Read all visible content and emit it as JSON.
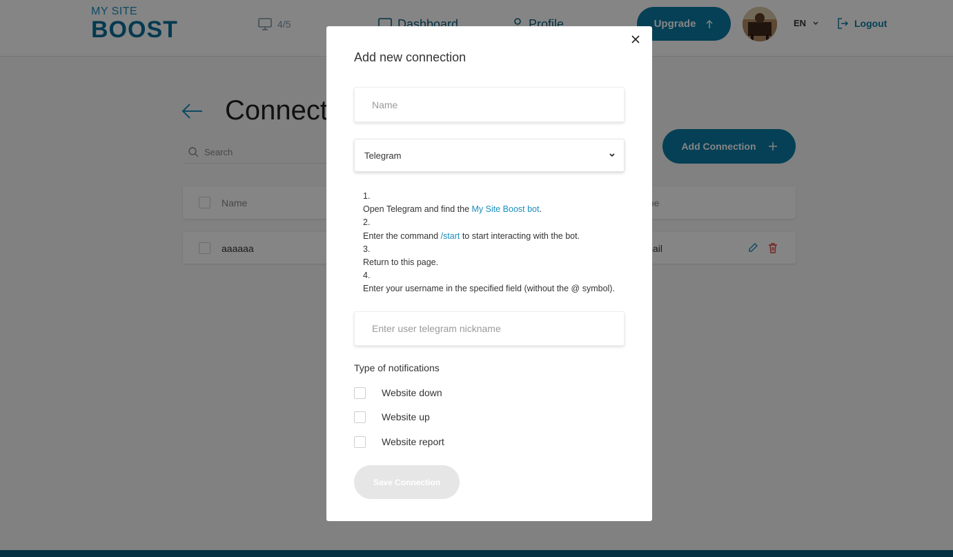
{
  "header": {
    "logo_top": "MY SITE",
    "logo_bottom": "BOOST",
    "sites_count": "4/5",
    "nav": [
      {
        "label": "Dashboard",
        "icon": "monitor-icon"
      },
      {
        "label": "Profile",
        "icon": "user-icon"
      }
    ],
    "upgrade_label": "Upgrade",
    "language": "EN",
    "logout_label": "Logout"
  },
  "page": {
    "title": "Connections",
    "search_placeholder": "Search",
    "add_button_label": "Add Connection",
    "table": {
      "columns": [
        "Name",
        "Type"
      ],
      "rows": [
        {
          "name": "aaaaaa",
          "type": "Email"
        }
      ]
    }
  },
  "modal": {
    "title": "Add new connection",
    "name_placeholder": "Name",
    "selected_type": "Telegram",
    "steps": [
      {
        "number": "1.",
        "text_before": "Open Telegram and find the ",
        "link": "My Site Boost bot",
        "text_after": "."
      },
      {
        "number": "2.",
        "text_before": "Enter the command ",
        "link": "/start",
        "text_after": " to start interacting with the bot."
      },
      {
        "number": "3.",
        "text": "Return to this page."
      },
      {
        "number": "4.",
        "text": "Enter your username in the specified field (without the @ symbol)."
      }
    ],
    "nickname_placeholder": "Enter user telegram nickname",
    "notifications_title": "Type of notifications",
    "options": [
      "Website down",
      "Website up",
      "Website report"
    ],
    "save_label": "Save Connection"
  },
  "colors": {
    "brand": "#0b7ba6",
    "brand_dark": "#0b5e80",
    "link": "#1a8fbf",
    "delete": "#e04040",
    "disabled": "#e6e6e6"
  }
}
